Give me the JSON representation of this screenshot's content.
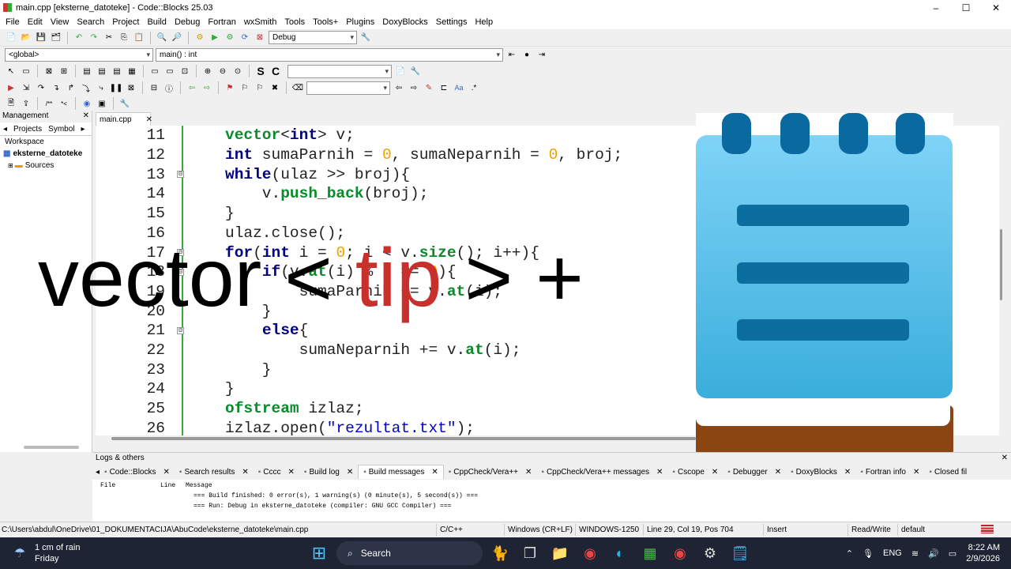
{
  "window": {
    "title": "main.cpp [eksterne_datoteke] - Code::Blocks 25.03",
    "controls": [
      "–",
      "☐",
      "✕"
    ]
  },
  "menu": [
    "File",
    "Edit",
    "View",
    "Search",
    "Project",
    "Build",
    "Debug",
    "Fortran",
    "wxSmith",
    "Tools",
    "Tools+",
    "Plugins",
    "DoxyBlocks",
    "Settings",
    "Help"
  ],
  "toolbar": {
    "build_target": "Debug",
    "scope": "<global>",
    "function": "main() : int"
  },
  "management": {
    "header": "Management",
    "tabs": [
      "Projects",
      "Symbol"
    ],
    "workspace": "Workspace",
    "project": "eksterne_datoteke",
    "folder": "Sources"
  },
  "editor": {
    "tab": "main.cpp",
    "lines": [
      {
        "n": "11",
        "code": [
          [
            "ty",
            "vector"
          ],
          [
            "p",
            "<"
          ],
          [
            "kw",
            "int"
          ],
          [
            "p",
            "> v;"
          ]
        ]
      },
      {
        "n": "12",
        "code": [
          [
            "kw",
            "int"
          ],
          [
            "p",
            " sumaParnih = "
          ],
          [
            "num",
            "0"
          ],
          [
            "p",
            ", sumaNeparnih = "
          ],
          [
            "num",
            "0"
          ],
          [
            "p",
            ", broj;"
          ]
        ]
      },
      {
        "n": "13",
        "code": [
          [
            "kw",
            "while"
          ],
          [
            "p",
            "(ulaz >> broj){"
          ]
        ],
        "fold": true
      },
      {
        "n": "14",
        "code": [
          [
            "p",
            "    v."
          ],
          [
            "ty",
            "push_back"
          ],
          [
            "p",
            "(broj);"
          ]
        ]
      },
      {
        "n": "15",
        "code": [
          [
            "p",
            "}"
          ]
        ]
      },
      {
        "n": "16",
        "code": [
          [
            "p",
            "ulaz.close();"
          ]
        ]
      },
      {
        "n": "17",
        "code": [
          [
            "kw",
            "for"
          ],
          [
            "p",
            "("
          ],
          [
            "kw",
            "int"
          ],
          [
            "p",
            " i = "
          ],
          [
            "num",
            "0"
          ],
          [
            "p",
            "; i < v."
          ],
          [
            "ty",
            "size"
          ],
          [
            "p",
            "(); i++){"
          ]
        ],
        "fold": true
      },
      {
        "n": "18",
        "code": [
          [
            "p",
            "    "
          ],
          [
            "kw",
            "if"
          ],
          [
            "p",
            "(v."
          ],
          [
            "ty",
            "at"
          ],
          [
            "p",
            "(i) % "
          ],
          [
            "num",
            "2"
          ],
          [
            "p",
            " == "
          ],
          [
            "num",
            "0"
          ],
          [
            "p",
            "){"
          ]
        ],
        "fold": true
      },
      {
        "n": "19",
        "code": [
          [
            "p",
            "        sumaParnih += v."
          ],
          [
            "ty",
            "at"
          ],
          [
            "p",
            "(i);"
          ]
        ]
      },
      {
        "n": "20",
        "code": [
          [
            "p",
            "    }"
          ]
        ]
      },
      {
        "n": "21",
        "code": [
          [
            "p",
            "    "
          ],
          [
            "kw",
            "else"
          ],
          [
            "p",
            "{"
          ]
        ],
        "fold": true
      },
      {
        "n": "22",
        "code": [
          [
            "p",
            "        sumaNeparnih += v."
          ],
          [
            "ty",
            "at"
          ],
          [
            "p",
            "(i);"
          ]
        ]
      },
      {
        "n": "23",
        "code": [
          [
            "p",
            "    }"
          ]
        ]
      },
      {
        "n": "24",
        "code": [
          [
            "p",
            "}"
          ]
        ]
      },
      {
        "n": "25",
        "code": [
          [
            "ty",
            "ofstream"
          ],
          [
            "p",
            " izlaz;"
          ]
        ]
      },
      {
        "n": "26",
        "code": [
          [
            "p",
            "izlaz.open("
          ],
          [
            "str",
            "\"rezultat.txt\""
          ],
          [
            "p",
            ");"
          ]
        ]
      }
    ]
  },
  "overlay": {
    "part1": "vector < ",
    "part2": "tip",
    "part3": " > +"
  },
  "logs": {
    "header": "Logs & others",
    "tabs": [
      "Code::Blocks",
      "Search results",
      "Cccc",
      "Build log",
      "Build messages",
      "CppCheck/Vera++",
      "CppCheck/Vera++ messages",
      "Cscope",
      "Debugger",
      "DoxyBlocks",
      "Fortran info",
      "Closed fil"
    ],
    "active_tab": "Build messages",
    "columns": [
      "File",
      "Line",
      "Message"
    ],
    "messages": [
      "=== Build finished: 0 error(s), 1 warning(s) (0 minute(s), 5 second(s)) ===",
      "=== Run: Debug in eksterne_datoteke (compiler: GNU GCC Compiler) ==="
    ]
  },
  "status": {
    "path": "C:\\Users\\abdul\\OneDrive\\01_DOKUMENTACIJA\\AbuCode\\eksterne_datoteke\\main.cpp",
    "language": "C/C++",
    "eol": "Windows (CR+LF)",
    "encoding": "WINDOWS-1250",
    "position": "Line 29, Col 19, Pos 704",
    "mode": "Insert",
    "access": "Read/Write",
    "profile": "default"
  },
  "taskbar": {
    "weather_title": "1 cm of rain",
    "weather_sub": "Friday",
    "search": "Search",
    "lang": "ENG",
    "time": "8:22 AM",
    "date": "2/9/2026"
  },
  "colors": {
    "accent_green": "#33aa33",
    "keyword": "#00007f",
    "type": "#0a8a2a",
    "overlay_red": "#c8302b",
    "notepad_blue": "#4fb8e6"
  }
}
